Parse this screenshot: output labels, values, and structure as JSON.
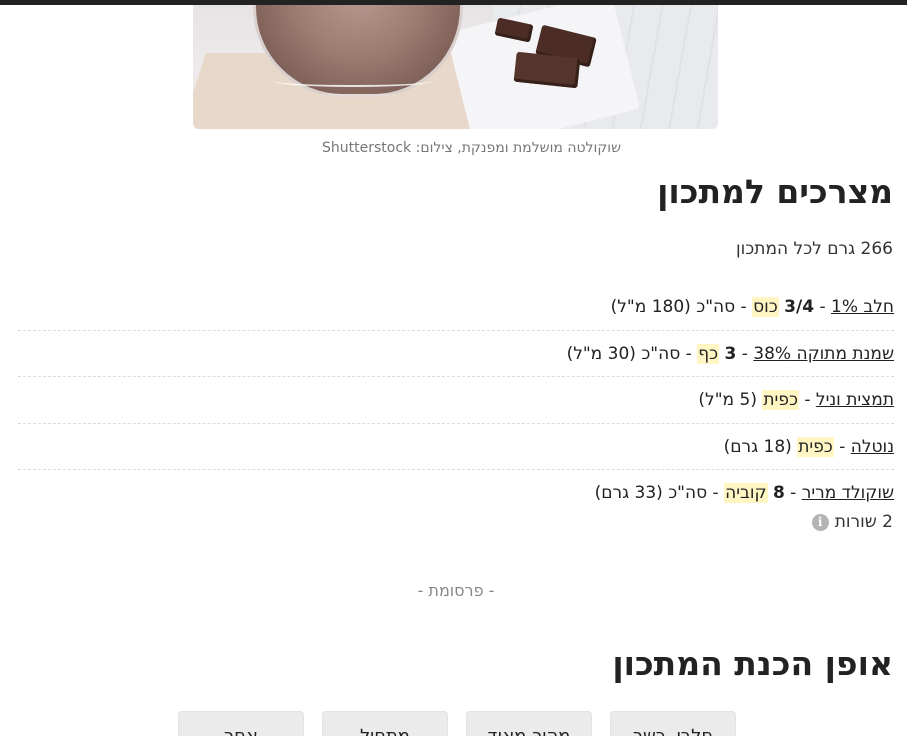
{
  "hero": {
    "image_alt": "שוקולטה",
    "caption": "שוקולטה מושלמת ומפנקת, צילום: Shutterstock"
  },
  "ingredients": {
    "title": "מצרכים למתכון",
    "yield": "266 גרם לכל המתכון",
    "items": [
      {
        "name": "חלב 1%",
        "sep1": " - ",
        "qty": "3/4",
        "unit": "כוס",
        "sep2": " - ",
        "rest": "סה\"כ (180 מ\"ל)"
      },
      {
        "name": "שמנת מתוקה 38%",
        "sep1": " - ",
        "qty": "3",
        "unit": "כף",
        "sep2": " - ",
        "rest": "סה\"כ (30 מ\"ל)"
      },
      {
        "name": "תמצית וניל",
        "sep1": " - ",
        "qty": "",
        "unit": "כפית",
        "sep2": " ",
        "rest": "(5 מ\"ל)"
      },
      {
        "name": "נוטלה",
        "sep1": " - ",
        "qty": "",
        "unit": "כפית",
        "sep2": " ",
        "rest": "(18 גרם)"
      },
      {
        "name": "שוקולד מריר",
        "sep1": " - ",
        "qty": "8",
        "unit": "קוביה",
        "sep2": " - ",
        "rest": "סה\"כ (33 גרם)"
      }
    ],
    "rows_note": "2 שורות",
    "info_icon": "info-icon"
  },
  "ad": {
    "label": "- פרסומת -"
  },
  "method": {
    "title": "אופן הכנת המתכון",
    "tags": [
      "חלבי, כשר",
      "מהיר מאוד",
      "מתחיל",
      "אחר"
    ]
  },
  "colors": {
    "highlight": "#fff6c4",
    "tag_bg": "#ebebeb",
    "topbar": "#222222"
  }
}
